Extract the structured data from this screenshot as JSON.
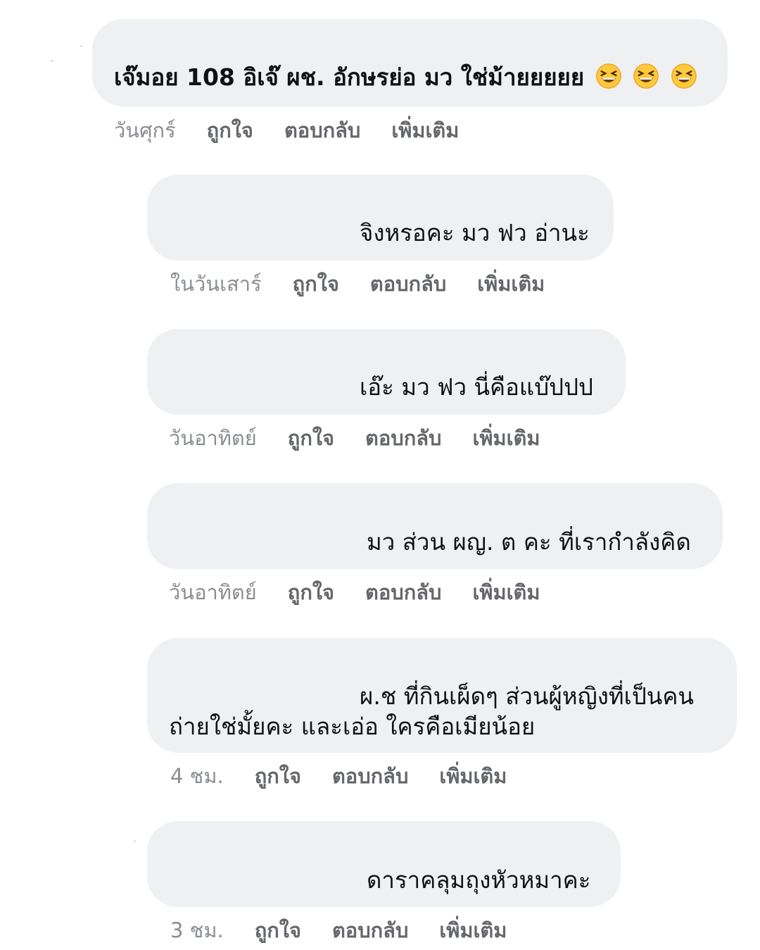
{
  "comments": [
    {
      "text": "เจ๊มอย 108 อิเจ๊ ผช. อักษรย่อ มว ใช่ม้ายยยยย",
      "emoji_count": 3,
      "emoji_name": "laughing-face-icon",
      "time": "วันศุกร์",
      "like": "ถูกใจ",
      "reply": "ตอบกลับ",
      "more": "เพิ่มเติม"
    },
    {
      "text": "จิงหรอคะ มว ฟว อ่านะ",
      "time": "ในวันเสาร์",
      "like": "ถูกใจ",
      "reply": "ตอบกลับ",
      "more": "เพิ่มเติม"
    },
    {
      "text": "เอ๊ะ มว ฟว นี่คือแบ๊ปปป",
      "time": "วันอาทิตย์",
      "like": "ถูกใจ",
      "reply": "ตอบกลับ",
      "more": "เพิ่มเติม"
    },
    {
      "text": "มว ส่วน ผญ. ต คะ ที่เรากำลังคิด",
      "time": "วันอาทิตย์",
      "like": "ถูกใจ",
      "reply": "ตอบกลับ",
      "more": "เพิ่มเติม"
    },
    {
      "text_line1": "ผ.ช ที่กินเผ็ดๆ ส่วนผู้หญิงที่เป็นคน",
      "text_line2": "ถ่ายใช่มั้ยคะ และเอ่อ ใครคือเมียน้อย",
      "time": "4 ชม.",
      "like": "ถูกใจ",
      "reply": "ตอบกลับ",
      "more": "เพิ่มเติม"
    },
    {
      "text": "ดาราคลุมถุงหัวหมาคะ",
      "time": "3 ชม.",
      "like": "ถูกใจ",
      "reply": "ตอบกลับ",
      "more": "เพิ่มเติม"
    }
  ],
  "colors": {
    "bubble": "#eff0f2",
    "text": "#111111",
    "action": "#65676b",
    "emoji_face": "#ffc93c"
  }
}
